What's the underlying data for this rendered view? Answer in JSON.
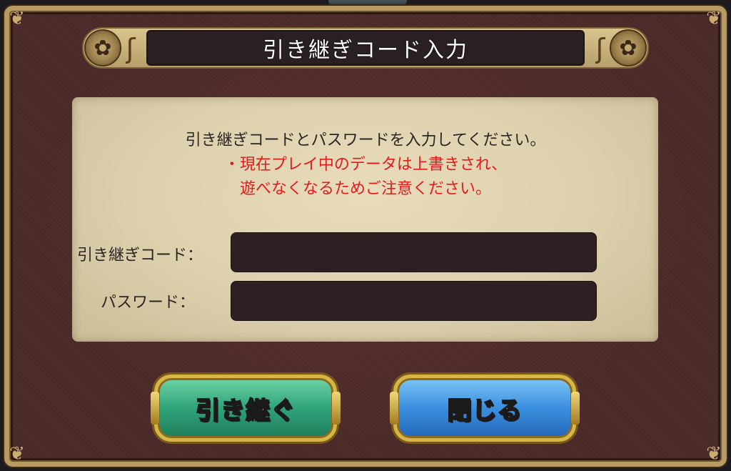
{
  "dialog": {
    "title": "引き継ぎコード入力",
    "message_line1": "引き継ぎコードとパスワードを入力してください。",
    "warning_line1": "・現在プレイ中のデータは上書きされ、",
    "warning_line2": "遊べなくなるためご注意ください。",
    "code_label": "引き継ぎコード：",
    "password_label": "パスワード：",
    "code_value": "",
    "password_value": ""
  },
  "buttons": {
    "transfer_label": "引き継ぐ",
    "close_label": "閉じる"
  },
  "colors": {
    "frame_bg": "#4a2a28",
    "panel_bg": "#ddd0ad",
    "warning_text": "#e21b1b",
    "transfer_button": "#2fa37a",
    "close_button": "#3b8fe0"
  },
  "icons": {
    "title_ornament_left": "flower-ornament-icon",
    "title_ornament_right": "flower-ornament-icon",
    "frame_corners": "corner-flourish-icon"
  }
}
